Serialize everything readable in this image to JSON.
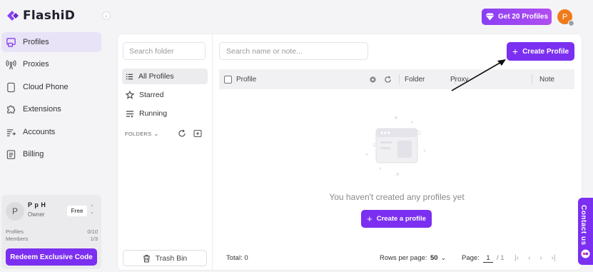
{
  "app": {
    "name": "FlashiD"
  },
  "colors": {
    "accent": "#7b2ff0",
    "active_nav_bg": "#e9e3f8",
    "avatar_orange": "#f07a1a"
  },
  "sidebar": {
    "items": [
      {
        "label": "Profiles",
        "icon": "profiles-icon",
        "active": true
      },
      {
        "label": "Proxies",
        "icon": "antenna-icon"
      },
      {
        "label": "Cloud Phone",
        "icon": "phone-icon"
      },
      {
        "label": "Extensions",
        "icon": "puzzle-icon"
      },
      {
        "label": "Accounts",
        "icon": "accounts-icon"
      },
      {
        "label": "Billing",
        "icon": "billing-icon"
      }
    ],
    "user": {
      "initial": "P",
      "name": "P p H",
      "role": "Owner",
      "plan": "Free",
      "profiles_label": "Profiles",
      "profiles_value": "0/10",
      "members_label": "Members",
      "members_value": "1/3",
      "redeem_label": "Redeem Exclusive Code"
    }
  },
  "topbar": {
    "upgrade_label": "Get 20 Profiles",
    "avatar_initial": "P"
  },
  "folders": {
    "search_placeholder": "Search folder",
    "items": [
      {
        "label": "All Profiles",
        "icon": "list-icon",
        "active": true
      },
      {
        "label": "Starred",
        "icon": "star-icon"
      },
      {
        "label": "Running",
        "icon": "running-icon"
      }
    ],
    "section_label": "FOLDERS",
    "trash_label": "Trash Bin"
  },
  "profiles": {
    "search_placeholder": "Search name or note...",
    "create_label": "Create Profile",
    "columns": {
      "profile": "Profile",
      "folder": "Folder",
      "proxy": "Proxy",
      "note": "Note"
    },
    "empty_message": "You haven't created any profiles yet",
    "create_profile_label": "Create a profile"
  },
  "pagination": {
    "total": "Total: 0",
    "rows_label": "Rows per page:",
    "rows_value": "50",
    "page_label": "Page:",
    "page_value": "1",
    "page_total": "/ 1"
  },
  "contact": {
    "label": "Contact us"
  }
}
